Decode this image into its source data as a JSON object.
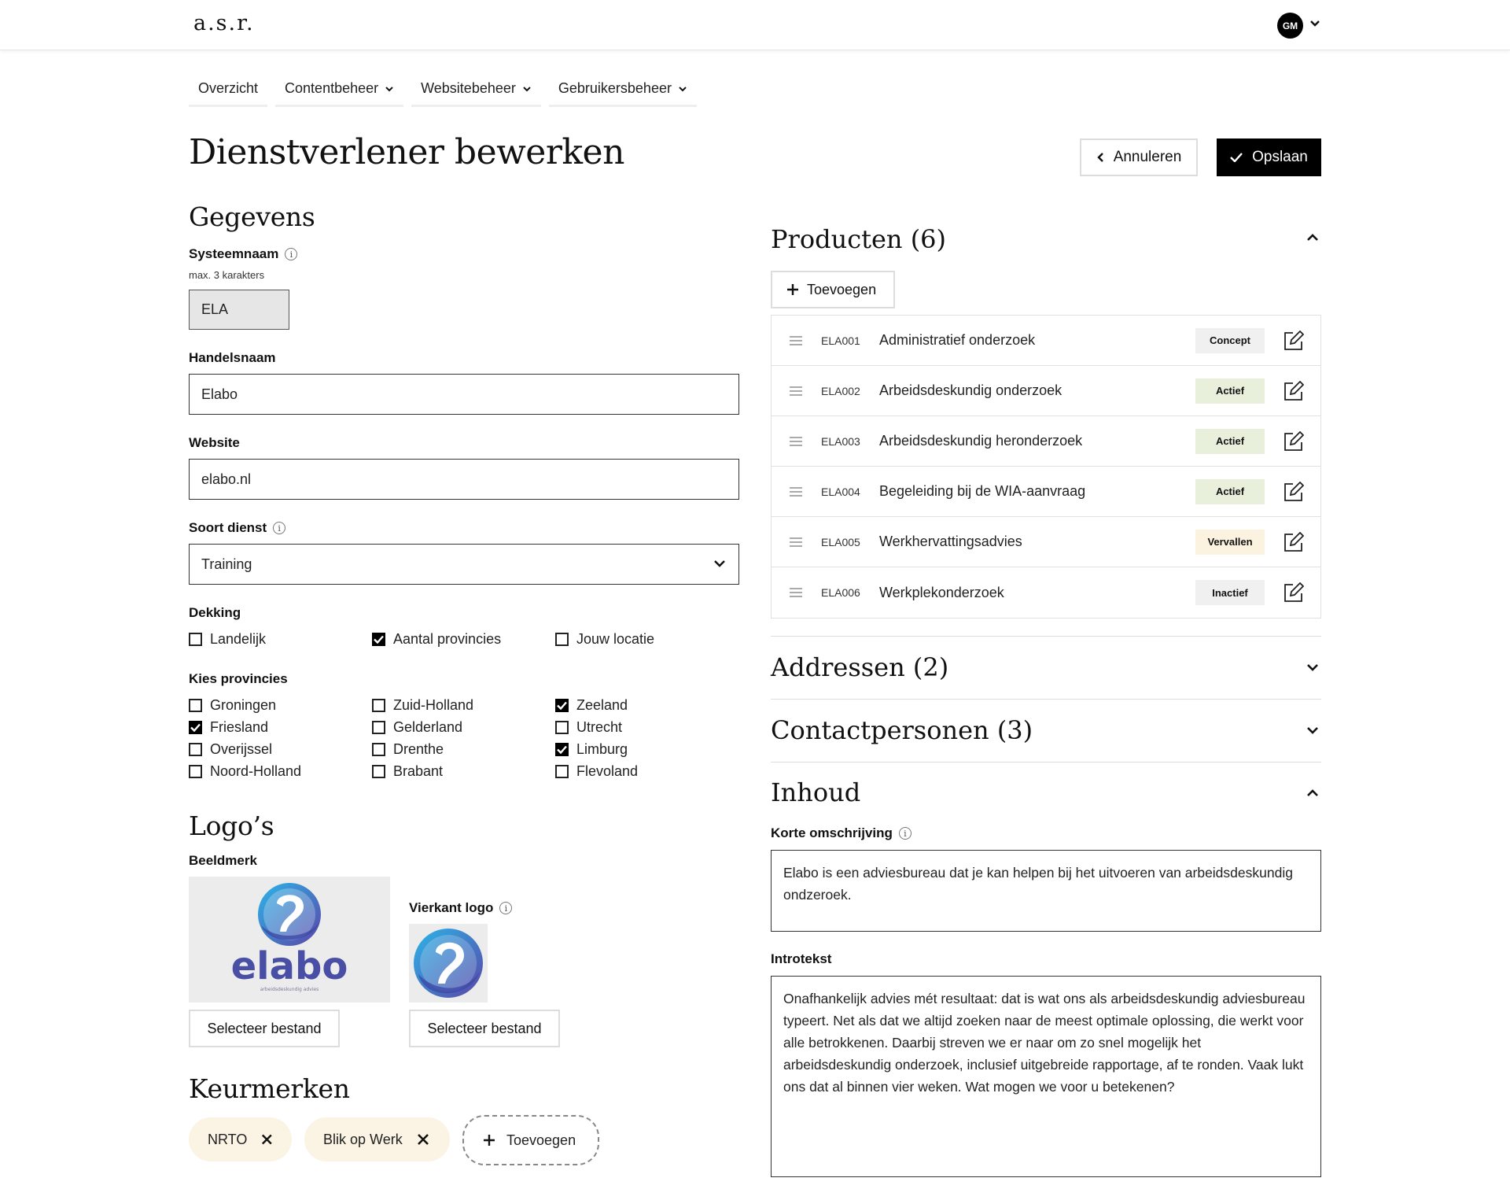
{
  "header": {
    "logo": "a.s.r.",
    "avatar_initials": "GM"
  },
  "nav": [
    {
      "label": "Overzicht",
      "has_dropdown": false
    },
    {
      "label": "Contentbeheer",
      "has_dropdown": true
    },
    {
      "label": "Websitebeheer",
      "has_dropdown": true
    },
    {
      "label": "Gebruikersbeheer",
      "has_dropdown": true
    }
  ],
  "page": {
    "title": "Dienstverlener bewerken",
    "cancel_label": "Annuleren",
    "save_label": "Opslaan"
  },
  "gegevens": {
    "title": "Gegevens",
    "systeemnaam_label": "Systeemnaam",
    "systeemnaam_hint": "max. 3 karakters",
    "systeemnaam_value": "ELA",
    "handelsnaam_label": "Handelsnaam",
    "handelsnaam_value": "Elabo",
    "website_label": "Website",
    "website_value": "elabo.nl",
    "soort_label": "Soort dienst",
    "soort_value": "Training",
    "dekking_label": "Dekking",
    "dekking": [
      {
        "label": "Landelijk",
        "checked": false
      },
      {
        "label": "Aantal provincies",
        "checked": true
      },
      {
        "label": "Jouw locatie",
        "checked": false
      }
    ],
    "provincies_label": "Kies provincies",
    "provincies": [
      {
        "label": "Groningen",
        "checked": false
      },
      {
        "label": "Friesland",
        "checked": true
      },
      {
        "label": "Overijssel",
        "checked": false
      },
      {
        "label": "Noord-Holland",
        "checked": false
      },
      {
        "label": "Zuid-Holland",
        "checked": false
      },
      {
        "label": "Gelderland",
        "checked": false
      },
      {
        "label": "Drenthe",
        "checked": false
      },
      {
        "label": "Brabant",
        "checked": false
      },
      {
        "label": "Zeeland",
        "checked": true
      },
      {
        "label": "Utrecht",
        "checked": false
      },
      {
        "label": "Limburg",
        "checked": true
      },
      {
        "label": "Flevoland",
        "checked": false
      }
    ]
  },
  "logos": {
    "title": "Logo’s",
    "beeldmerk_label": "Beeldmerk",
    "beeldmerk_wordmark": "elabo",
    "beeldmerk_tagline": "arbeidsdeskundig advies",
    "vierkant_label": "Vierkant logo",
    "select_label": "Selecteer bestand"
  },
  "keurmerken": {
    "title": "Keurmerken",
    "items": [
      "NRTO",
      "Blik op Werk"
    ],
    "add_label": "Toevoegen"
  },
  "producten": {
    "title": "Producten (6)",
    "add_label": "Toevoegen",
    "items": [
      {
        "code": "ELA001",
        "name": "Administratief onderzoek",
        "status": "Concept",
        "status_color": "#f0f0f0"
      },
      {
        "code": "ELA002",
        "name": "Arbeidsdeskundig onderzoek",
        "status": "Actief",
        "status_color": "#e8f0dc"
      },
      {
        "code": "ELA003",
        "name": "Arbeidsdeskundig heronderzoek",
        "status": "Actief",
        "status_color": "#e8f0dc"
      },
      {
        "code": "ELA004",
        "name": "Begeleiding bij de WIA-aanvraag",
        "status": "Actief",
        "status_color": "#e8f0dc"
      },
      {
        "code": "ELA005",
        "name": "Werkhervattingsadvies",
        "status": "Vervallen",
        "status_color": "#fbf3e0"
      },
      {
        "code": "ELA006",
        "name": "Werkplekonderzoek",
        "status": "Inactief",
        "status_color": "#f0f0f0"
      }
    ]
  },
  "adressen": {
    "title": "Addressen (2)"
  },
  "contactpersonen": {
    "title": "Contactpersonen (3)"
  },
  "inhoud": {
    "title": "Inhoud",
    "korte_label": "Korte omschrijving",
    "korte_value": "Elabo is een adviesbureau dat je kan helpen bij het uitvoeren van arbeidsdeskundig ondzeroek.",
    "intro_label": "Introtekst",
    "intro_value": "Onafhankelijk advies mét resultaat: dat is wat ons als arbeidsdeskundig adviesbureau typeert. Net als dat we altijd zoeken naar de meest optimale oplossing, die werkt voor alle betrokkenen. Daarbij streven we er naar om zo snel mogelijk het arbeidsdeskundig onderzoek, inclusief uitgebreide rapportage, af te ronden. Vaak lukt ons dat al binnen vier weken. Wat mogen we voor u betekenen?"
  },
  "colors": {
    "primary": "#000000",
    "pill_bg": "#fbf3e3",
    "active_badge": "#e8f0dc",
    "vervallen_badge": "#fbf3e0",
    "neutral_badge": "#f0f0f0"
  }
}
